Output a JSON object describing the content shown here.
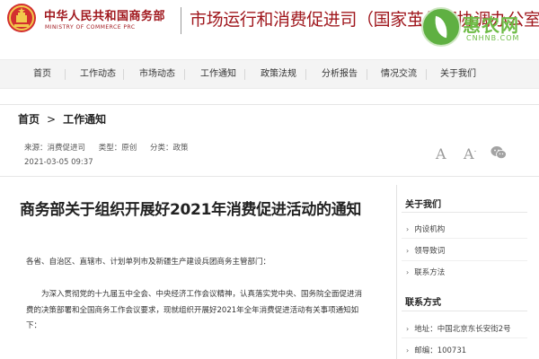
{
  "header": {
    "ministry_cn": "中华人民共和国商务部",
    "ministry_en": "MINISTRY OF COMMERCE PRC",
    "dept_title": "市场运行和消费促进司（国家茧丝绸协调办公室）",
    "watermark_cn": "惠农网",
    "watermark_en": "CNHNB.COM",
    "emblem_icon": "national-emblem-icon",
    "accent_color": "#a0181e"
  },
  "nav": {
    "items": [
      {
        "label": "首页"
      },
      {
        "label": "工作动态"
      },
      {
        "label": "市场动态"
      },
      {
        "label": "工作通知"
      },
      {
        "label": "政策法规"
      },
      {
        "label": "分析报告"
      },
      {
        "label": "情况交流"
      },
      {
        "label": "关于我们"
      }
    ]
  },
  "breadcrumb": {
    "home": "首页",
    "arrow": ">",
    "current": "工作通知"
  },
  "meta": {
    "source": "来源：消费促进司",
    "type": "类型：原创",
    "category": "分类：政策",
    "time": "2021-03-05 09:37"
  },
  "tools": {
    "font_large": "A",
    "font_small": "A",
    "font_small_sup": "-",
    "share_icon": "wechat-icon"
  },
  "article": {
    "title": "商务部关于组织开展好2021年消费促进活动的通知",
    "salutation": "各省、自治区、直辖市、计划单列市及新疆生产建设兵团商务主管部门：",
    "para_line1": "为深入贯彻党的十九届五中全会、中央经济工作会议精神，认真落实党中央、国务院全面促进消",
    "para_line2": "费的决策部署和全国商务工作会议要求，现就组织开展好2021年全年消费促进活动有关事项通知如",
    "para_line3": "下："
  },
  "sidebar": {
    "about_title": "关于我们",
    "about_items": [
      {
        "label": "内设机构"
      },
      {
        "label": "领导致词"
      },
      {
        "label": "联系方法"
      }
    ],
    "contact_title": "联系方式",
    "address": "地址：中国北京东长安街2号",
    "postcode": "邮编：100731"
  }
}
